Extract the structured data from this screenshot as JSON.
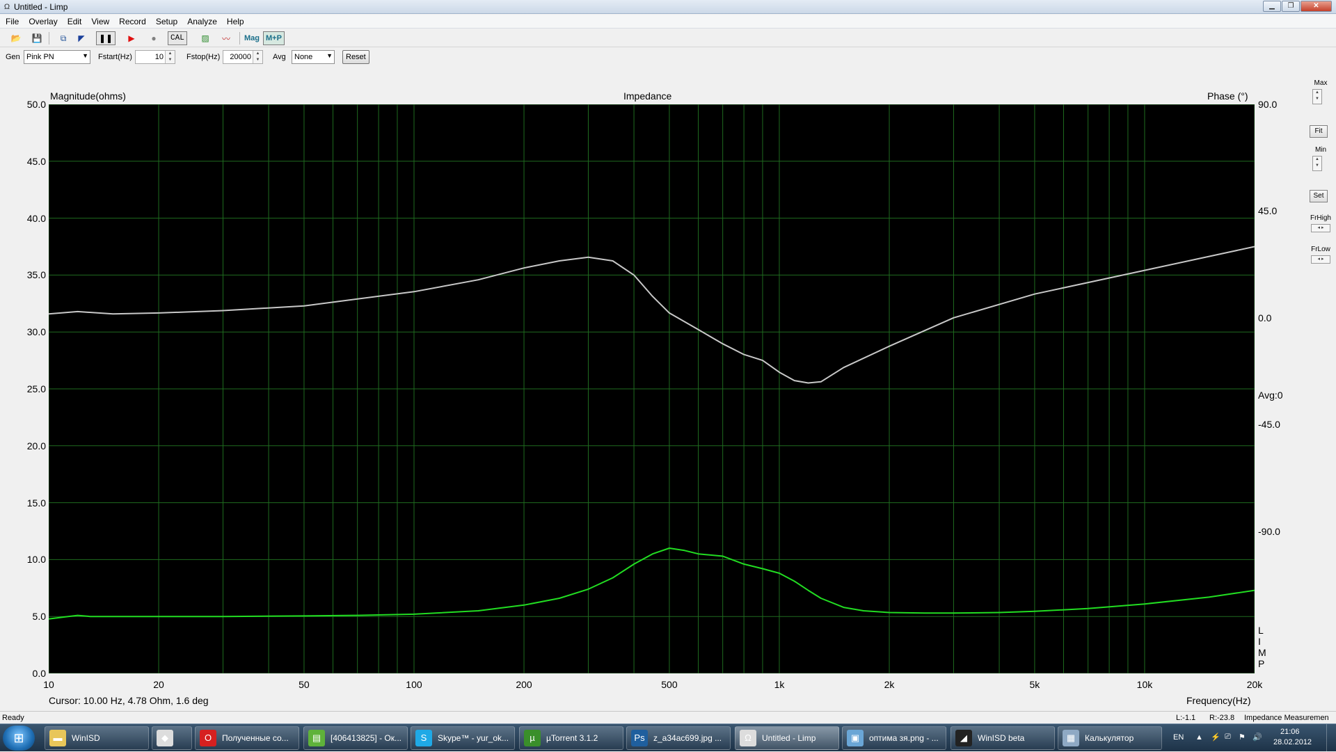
{
  "window": {
    "title": "Untitled - Limp"
  },
  "menu": [
    "File",
    "Overlay",
    "Edit",
    "View",
    "Record",
    "Setup",
    "Analyze",
    "Help"
  ],
  "toolbar": {
    "cal_label": "CAL",
    "mag_label": "Mag",
    "mp_label": "M+P"
  },
  "controls": {
    "gen_label": "Gen",
    "gen_value": "Pink PN",
    "fstart_label": "Fstart(Hz)",
    "fstart_value": "10",
    "fstop_label": "Fstop(Hz)",
    "fstop_value": "20000",
    "avg_label": "Avg",
    "avg_value": "None",
    "reset_label": "Reset"
  },
  "plot": {
    "left_axis_title": "Magnitude(ohms)",
    "title": "Impedance",
    "right_axis_title": "Phase (°)",
    "x_axis_title": "Frequency(Hz)",
    "avg_readout": "Avg:0",
    "limp_vertical": [
      "L",
      "I",
      "M",
      "P"
    ],
    "cursor_readout": "Cursor: 10.00 Hz, 4.78 Ohm, 1.6 deg"
  },
  "chart_data": {
    "type": "line",
    "title": "Impedance",
    "xlabel": "Frequency(Hz)",
    "ylabel": "Magnitude(ohms)",
    "y2label": "Phase (°)",
    "xscale": "log",
    "xlim": [
      10,
      20000
    ],
    "ylim": [
      0,
      50
    ],
    "y2lim": [
      -150,
      90
    ],
    "grid": true,
    "x_ticks": [
      "10",
      "20",
      "50",
      "100",
      "200",
      "500",
      "1k",
      "2k",
      "5k",
      "10k",
      "20k"
    ],
    "x_tick_values": [
      10,
      20,
      50,
      100,
      200,
      500,
      1000,
      2000,
      5000,
      10000,
      20000
    ],
    "y_ticks": [
      "0.0",
      "5.0",
      "10.0",
      "15.0",
      "20.0",
      "25.0",
      "30.0",
      "35.0",
      "40.0",
      "45.0",
      "50.0"
    ],
    "y2_ticks": [
      "90.0",
      "45.0",
      "0.0",
      "-45.0",
      "-90.0"
    ],
    "y2_tick_values": [
      90,
      45,
      0,
      -45,
      -90
    ],
    "series": [
      {
        "color": "#22dd22",
        "axis": "left",
        "x": [
          10,
          11,
          12,
          13,
          15,
          20,
          30,
          50,
          70,
          100,
          150,
          200,
          250,
          300,
          350,
          400,
          450,
          500,
          550,
          600,
          700,
          800,
          900,
          1000,
          1100,
          1200,
          1300,
          1500,
          1700,
          2000,
          2500,
          3000,
          4000,
          5000,
          7000,
          10000,
          15000,
          20000
        ],
        "y": [
          4.78,
          4.95,
          5.1,
          5.0,
          5.0,
          5.0,
          5.0,
          5.05,
          5.1,
          5.2,
          5.5,
          6.0,
          6.6,
          7.4,
          8.4,
          9.6,
          10.5,
          11.0,
          10.8,
          10.5,
          10.3,
          9.6,
          9.2,
          8.8,
          8.1,
          7.3,
          6.6,
          5.8,
          5.5,
          5.35,
          5.3,
          5.3,
          5.35,
          5.45,
          5.7,
          6.1,
          6.7,
          7.3
        ]
      },
      {
        "color": "#c8c8c8",
        "axis": "right",
        "x": [
          10,
          12,
          15,
          20,
          30,
          50,
          100,
          150,
          200,
          250,
          300,
          350,
          400,
          450,
          500,
          600,
          700,
          800,
          900,
          1000,
          1100,
          1200,
          1300,
          1500,
          2000,
          3000,
          5000,
          10000,
          20000
        ],
        "y": [
          1.6,
          2.6,
          1.6,
          2.0,
          3.0,
          5.0,
          11.0,
          16.0,
          21.0,
          24.0,
          25.5,
          24.0,
          18.0,
          9.0,
          2.0,
          -5.0,
          -11.0,
          -15.5,
          -18.0,
          -23.0,
          -26.5,
          -27.5,
          -27.0,
          -21.0,
          -12.0,
          0.0,
          10.0,
          20.0,
          30.0
        ]
      }
    ]
  },
  "sidepanel": {
    "max_label": "Max",
    "fit_label": "Fit",
    "min_label": "Min",
    "set_label": "Set",
    "frhigh_label": "FrHigh",
    "frlow_label": "FrLow"
  },
  "statusbar": {
    "left": "Ready",
    "l_value": "L:-1.1",
    "r_value": "R:-23.8",
    "right": "Impedance Measuremen"
  },
  "taskbar": {
    "items": [
      {
        "label": "WinISD",
        "icon": "folder-icon",
        "color": "#e8c65a"
      },
      {
        "label": "",
        "icon": "fox-icon",
        "color": "#dddddd"
      },
      {
        "label": "Полученные со...",
        "icon": "opera-icon",
        "color": "#d62020"
      },
      {
        "label": "[406413825] - Ок...",
        "icon": "chat-icon",
        "color": "#5fb23a"
      },
      {
        "label": "Skype™ - yur_ok...",
        "icon": "skype-icon",
        "color": "#1fa9e6"
      },
      {
        "label": "µTorrent 3.1.2",
        "icon": "utorrent-icon",
        "color": "#3a8f2a"
      },
      {
        "label": "z_a34ac699.jpg ...",
        "icon": "photoshop-icon",
        "color": "#1f5f9e"
      },
      {
        "label": "Untitled - Limp",
        "icon": "omega-icon",
        "color": "#dddddd"
      },
      {
        "label": "оптима зя.png - ...",
        "icon": "image-viewer-icon",
        "color": "#6aa6d6"
      },
      {
        "label": "WinISD beta",
        "icon": "speaker-icon",
        "color": "#222222"
      },
      {
        "label": "Калькулятор",
        "icon": "calculator-icon",
        "color": "#8fa9c4"
      }
    ],
    "lang": "EN",
    "time": "21:06",
    "date": "28.02.2012"
  }
}
